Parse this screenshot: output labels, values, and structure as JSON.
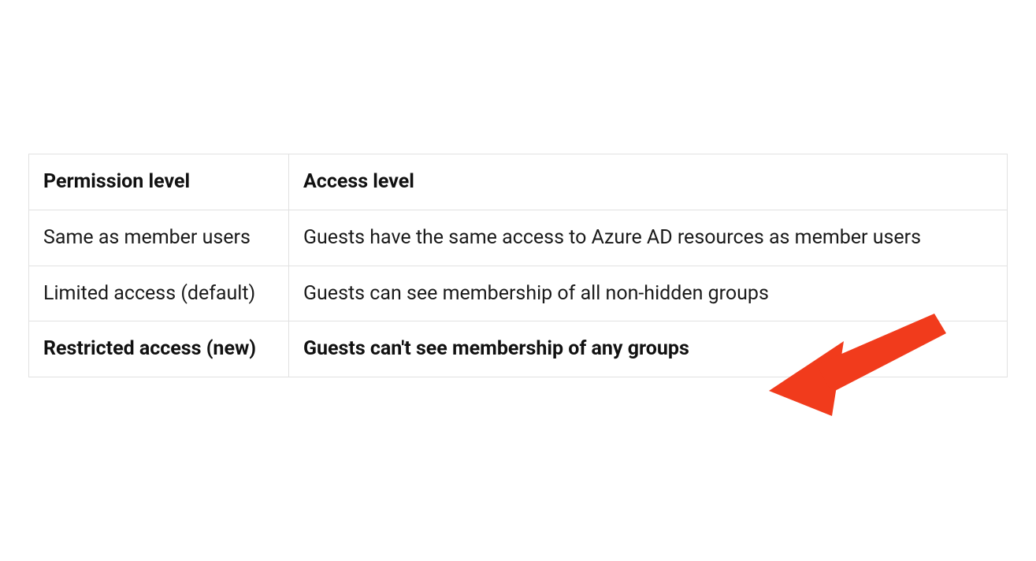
{
  "table": {
    "headers": {
      "permission": "Permission level",
      "access": "Access level"
    },
    "rows": [
      {
        "permission": "Same as member users",
        "access": "Guests have the same access to Azure AD resources as member users",
        "bold": false
      },
      {
        "permission": "Limited access (default)",
        "access": "Guests can see membership of all non-hidden groups",
        "bold": false
      },
      {
        "permission": "Restricted access (new)",
        "access": "Guests can't see membership of any groups",
        "bold": true
      }
    ]
  },
  "annotation": {
    "type": "arrow",
    "color": "#f13b1c"
  }
}
